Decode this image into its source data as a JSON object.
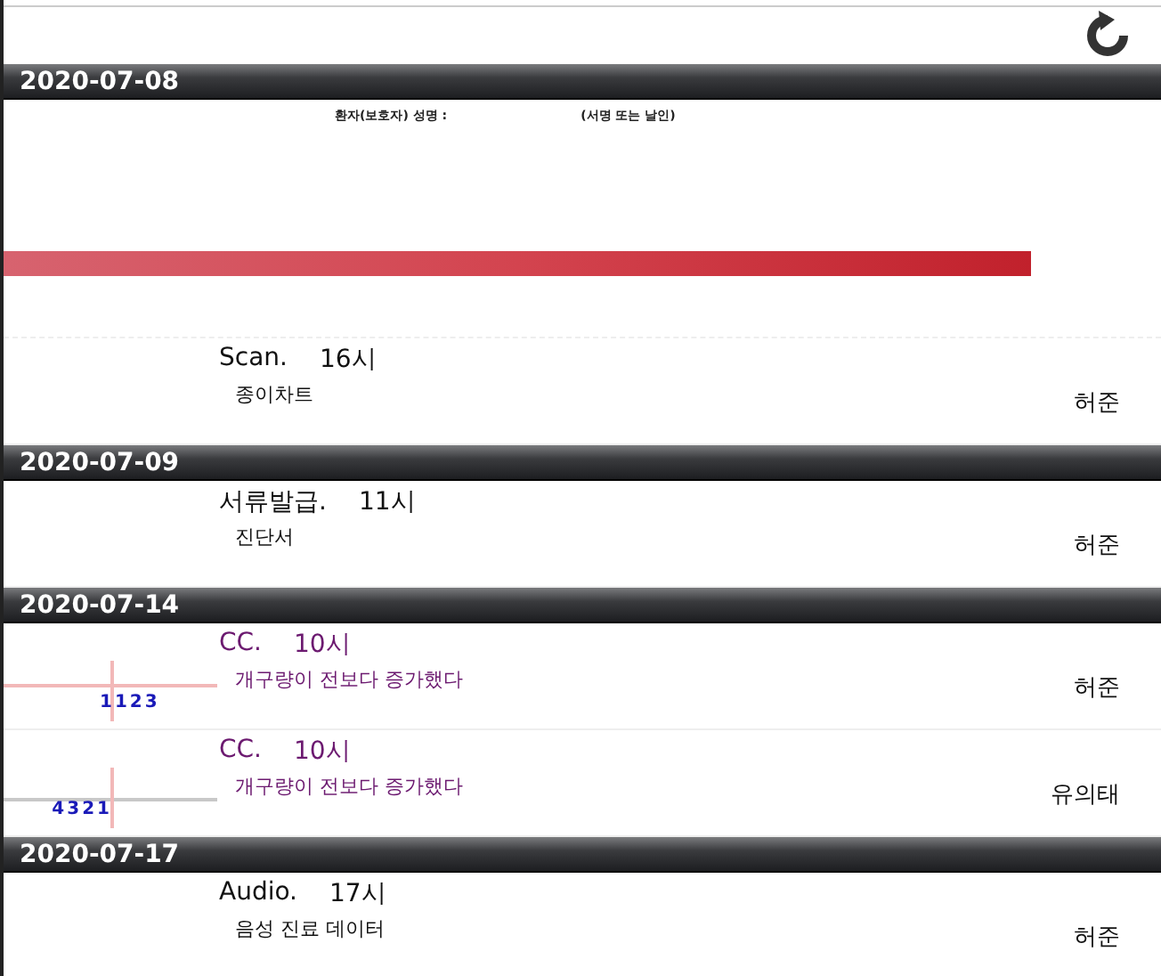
{
  "groups": [
    {
      "date": "2020-07-08",
      "items": [
        {
          "kind": "signature",
          "label": "환자(보호자) 성명 :",
          "hint": "(서명 또는 날인)"
        },
        {
          "kind": "note",
          "title": "Scan.",
          "time": "16시",
          "detail": "종이차트",
          "doctor": "허준"
        }
      ]
    },
    {
      "date": "2020-07-09",
      "items": [
        {
          "kind": "note",
          "title": "서류발급.",
          "time": "11시",
          "detail": "진단서",
          "doctor": "허준"
        }
      ]
    },
    {
      "date": "2020-07-14",
      "items": [
        {
          "kind": "cc",
          "title": "CC.",
          "time": "10시",
          "detail": "개구량이 전보다 증가했다",
          "doctor": "허준",
          "thumb": "1123"
        },
        {
          "kind": "cc",
          "title": "CC.",
          "time": "10시",
          "detail": "개구량이 전보다 증가했다",
          "doctor": "유의태",
          "thumb": "4321"
        }
      ]
    },
    {
      "date": "2020-07-17",
      "items": [
        {
          "kind": "note",
          "title": "Audio.",
          "time": "17시",
          "detail": "음성 진료 데이터",
          "doctor": "허준"
        }
      ]
    }
  ]
}
